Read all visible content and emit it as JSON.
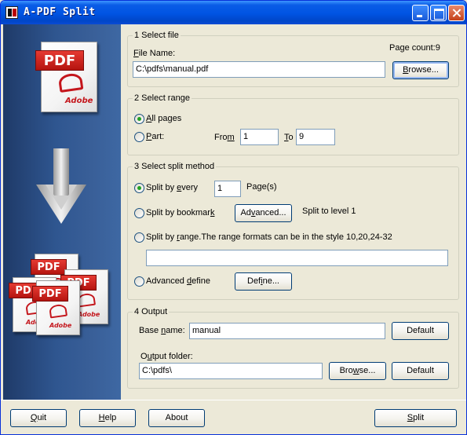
{
  "window": {
    "title": "A-PDF Split"
  },
  "side": {
    "tag": "PDF",
    "brand": "Adobe"
  },
  "select_file": {
    "legend": "1 Select file",
    "file_name_label_pre": "",
    "file_name_label_mn": "F",
    "file_name_label_post": "ile Name:",
    "page_count": "Page count:9",
    "file_path": "C:\\pdfs\\manual.pdf",
    "browse_pre": "",
    "browse_mn": "B",
    "browse_post": "rowse..."
  },
  "select_range": {
    "legend": "2 Select range",
    "all_pages_mn": "A",
    "all_pages_post": "ll pages",
    "part_mn": "P",
    "part_post": "art:",
    "from_pre": "Fro",
    "from_mn": "m",
    "from_value": "1",
    "to_mn": "T",
    "to_post": "o",
    "to_value": "9"
  },
  "split_method": {
    "legend": "3 Select split method",
    "every_pre": "Split by ",
    "every_mn": "e",
    "every_post": "very",
    "every_value": "1",
    "every_unit": "Page(s)",
    "bookmark_pre": "Split by bookmar",
    "bookmark_mn": "k",
    "advanced_pre": "Ad",
    "advanced_mn": "v",
    "advanced_post": "anced...",
    "split_level": "Split to level 1",
    "range_pre": "Split by ",
    "range_mn": "r",
    "range_post": "ange.The range formats can be in the style 10,20,24-32",
    "range_value": "",
    "advdef_pre": "Advanced ",
    "advdef_mn": "d",
    "advdef_post": "efine",
    "define_pre": "Def",
    "define_mn": "i",
    "define_post": "ne..."
  },
  "output": {
    "legend": "4 Output",
    "base_pre": "Base ",
    "base_mn": "n",
    "base_post": "ame:",
    "base_value": "manual",
    "default_label": "Default",
    "folder_pre": "O",
    "folder_mn": "u",
    "folder_post": "tput folder:",
    "folder_value": "C:\\pdfs\\",
    "browse2_pre": "Bro",
    "browse2_mn": "w",
    "browse2_post": "se...",
    "default2_label": "Default"
  },
  "footer": {
    "quit_mn": "Q",
    "quit_post": "uit",
    "help_mn": "H",
    "help_post": "elp",
    "about_label": "About",
    "split_mn": "S",
    "split_post": "plit"
  },
  "colors": {
    "titlebar": "#0054e3",
    "side_panel": "#2f5690",
    "radio_dot": "#21a121"
  }
}
